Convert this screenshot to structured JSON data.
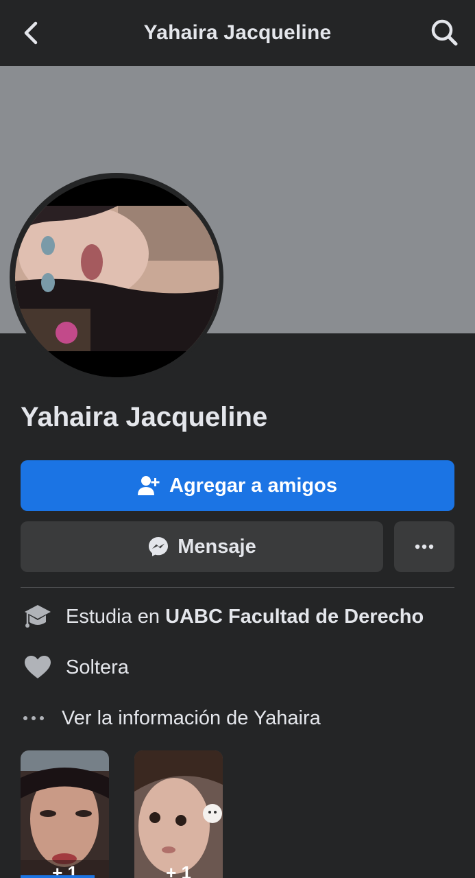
{
  "header": {
    "title": "Yahaira Jacqueline",
    "back_icon": "chevron-left-icon",
    "search_icon": "search-icon"
  },
  "profile": {
    "name": "Yahaira Jacqueline",
    "avatar": "profile-photo",
    "cover_color": "#8a8d91"
  },
  "actions": {
    "add_friend_label": "Agregar a amigos",
    "add_friend_icon": "add-person-icon",
    "message_label": "Mensaje",
    "message_icon": "messenger-icon",
    "more_icon": "more-dots-icon",
    "accent_color": "#1b74e4"
  },
  "info": {
    "study_prefix": "Estudia en ",
    "study_place": "UABC Facultad de Derecho",
    "study_icon": "graduation-cap-icon",
    "relationship": "Soltera",
    "relationship_icon": "heart-icon",
    "see_more": "Ver la información de Yahaira",
    "see_more_icon": "more-dots-icon"
  },
  "stories": [
    {
      "count": "+ 1"
    },
    {
      "count": "+ 1"
    }
  ]
}
